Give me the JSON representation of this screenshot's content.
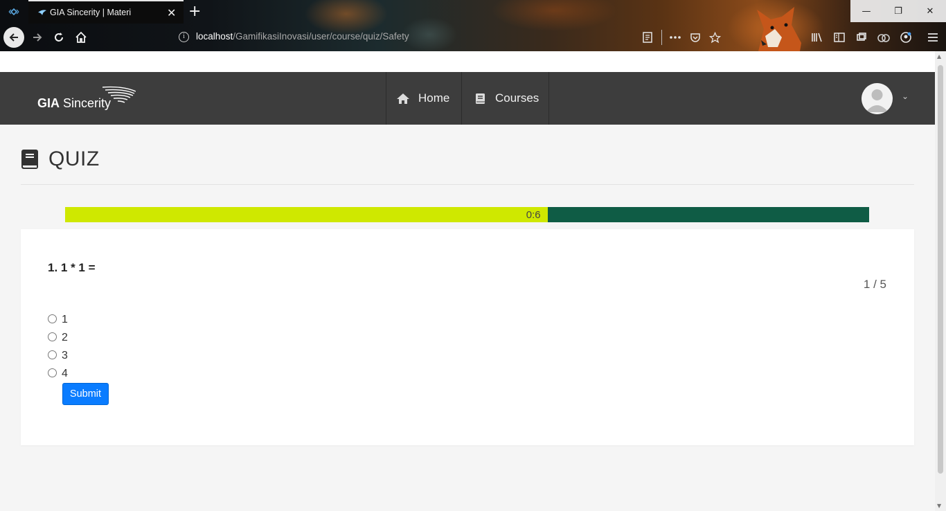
{
  "browser": {
    "tab_title": "GIA Sincerity | Materi",
    "tab_close": "✕",
    "new_tab": "+",
    "url_host": "localhost",
    "url_path": "/GamifikasiInovasi/user/course/quiz/Safety",
    "icons": [
      "tab-list-icon",
      "back-icon",
      "forward-icon",
      "reload-icon",
      "home-icon",
      "info-icon",
      "reader-icon",
      "more-icon",
      "pocket-icon",
      "star-icon",
      "library-icon",
      "sidebar-icon",
      "sync-icon",
      "extension-icon",
      "account-icon",
      "menu-icon"
    ],
    "window": {
      "minimize": "—",
      "restore": "❐",
      "close": "✕"
    }
  },
  "header": {
    "brand_bold": "GIA",
    "brand_rest": "Sincerity",
    "menu": [
      {
        "label": "Home",
        "icon": "home-icon"
      },
      {
        "label": "Courses",
        "icon": "book-icon"
      }
    ],
    "avatar_icon": "user-avatar",
    "chevron": "⌄"
  },
  "quiz": {
    "title": "QUIZ",
    "icon": "book-icon",
    "timer_text": "0:6",
    "timer_progress": 0.6,
    "colors": {
      "timer_fill": "#cfe800",
      "timer_track": "#0f5c45",
      "header_bg": "#3d3d3d",
      "submit": "#0a7cff"
    },
    "question": "1. 1 * 1 =",
    "counter": "1 / 5",
    "options": [
      "1",
      "2",
      "3",
      "4"
    ],
    "submit_label": "Submit"
  }
}
